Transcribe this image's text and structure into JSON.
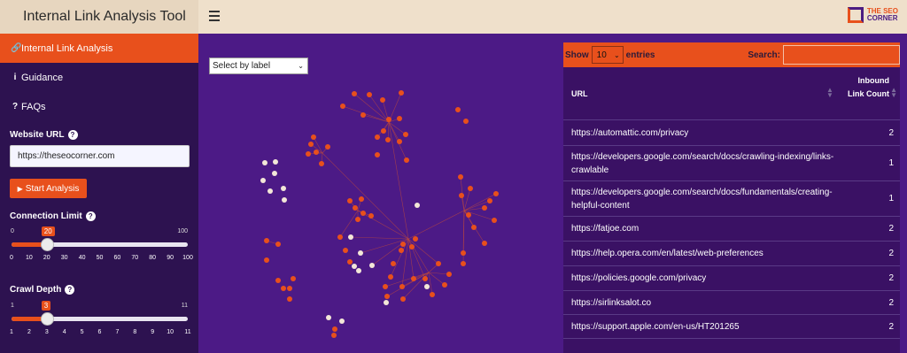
{
  "app": {
    "title": "Internal Link Analysis Tool"
  },
  "header": {
    "menu_icon": "hamburger-icon",
    "logo_line1": "THE SEO",
    "logo_line2": "CORNER"
  },
  "colors": {
    "accent": "#e8501c",
    "sidebar": "#2d1250",
    "main": "#4c1a86",
    "node_orange": "#e8501c",
    "node_light": "#f3e7d8"
  },
  "sidebar": {
    "nav": [
      {
        "label": "Internal Link Analysis",
        "icon": "link-icon"
      },
      {
        "label": "Guidance",
        "icon": "info-icon"
      },
      {
        "label": "FAQs",
        "icon": "question-icon"
      }
    ],
    "website_url_label": "Website URL",
    "website_url_value": "https://theseocorner.com",
    "start_button": "Start Analysis",
    "connection_limit": {
      "label": "Connection Limit",
      "min": "0",
      "max": "100",
      "value": "20",
      "fraction": 0.2,
      "ticks": [
        "0",
        "10",
        "20",
        "30",
        "40",
        "50",
        "60",
        "70",
        "80",
        "90",
        "100"
      ]
    },
    "crawl_depth": {
      "label": "Crawl Depth",
      "min": "1",
      "max": "11",
      "value": "3",
      "fraction": 0.2,
      "ticks": [
        "1",
        "2",
        "3",
        "4",
        "5",
        "6",
        "7",
        "8",
        "9",
        "10",
        "11"
      ]
    }
  },
  "graph": {
    "select_placeholder": "Select by label"
  },
  "table": {
    "show_label": "Show",
    "entries_value": "10",
    "entries_label": "entries",
    "search_label": "Search:",
    "columns": {
      "url": "URL",
      "count": "Inbound Link Count"
    },
    "rows": [
      {
        "url": "https://automattic.com/privacy",
        "count": "2"
      },
      {
        "url": "https://developers.google.com/search/docs/crawling-indexing/links-crawlable",
        "count": "1"
      },
      {
        "url": "https://developers.google.com/search/docs/fundamentals/creating-helpful-content",
        "count": "1"
      },
      {
        "url": "https://fatjoe.com",
        "count": "2"
      },
      {
        "url": "https://help.opera.com/en/latest/web-preferences",
        "count": "2"
      },
      {
        "url": "https://policies.google.com/privacy",
        "count": "2"
      },
      {
        "url": "https://sirlinksalot.co",
        "count": "2"
      },
      {
        "url": "https://support.apple.com/en-us/HT201265",
        "count": "2"
      }
    ]
  }
}
